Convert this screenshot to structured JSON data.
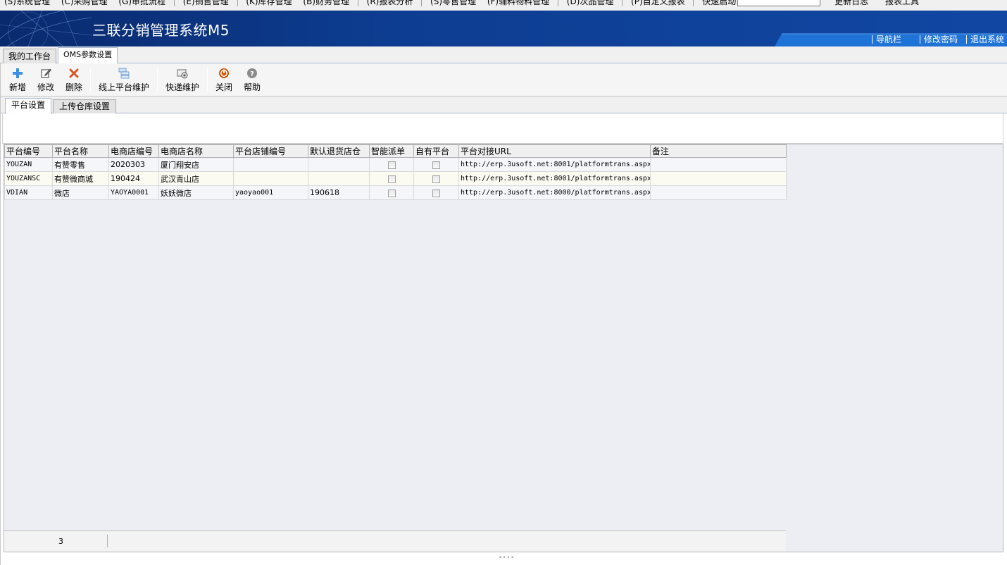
{
  "menu": {
    "items": [
      "(S)系统管理",
      "(C)采购管理",
      "(G)审批流程",
      "(E)销售管理",
      "(K)库存管理",
      "(B)财务管理",
      "(R)报表分析",
      "(S)零售管理",
      "(F)辅料物料管理",
      "(D)次品管理",
      "(P)自定义报表"
    ],
    "quick_start_label": "快速启动",
    "quick_start_value": "",
    "extra_items": [
      "更新日志",
      "报表工具"
    ]
  },
  "banner": {
    "title": "三联分销管理系统M5",
    "links": [
      "导航栏",
      "修改密码",
      "退出系统"
    ]
  },
  "main_tabs": [
    "我的工作台",
    "OMS参数设置"
  ],
  "toolbar": {
    "buttons": [
      "新增",
      "修改",
      "删除",
      "线上平台维护",
      "快递维护",
      "关闭",
      "帮助"
    ]
  },
  "sub_tabs": [
    "平台设置",
    "上传仓库设置"
  ],
  "grid": {
    "columns": [
      "平台编号",
      "平台名称",
      "电商店编号",
      "电商店名称",
      "平台店铺编号",
      "默认退货店仓",
      "智能派单",
      "自有平台",
      "平台对接URL",
      "备注"
    ],
    "rows": [
      {
        "code": "YOUZAN",
        "name": "有赞零售",
        "shop_code": "2020303",
        "shop_name": "厦门翔安店",
        "platform_shop_code": "",
        "return_store": "",
        "smart_dispatch": false,
        "own_platform": false,
        "url": "http://erp.3usoft.net:8001/platformtrans.aspx",
        "note": ""
      },
      {
        "code": "YOUZANSC",
        "name": "有赞微商城",
        "shop_code": "190424",
        "shop_name": "武汉青山店",
        "platform_shop_code": "",
        "return_store": "",
        "smart_dispatch": false,
        "own_platform": false,
        "url": "http://erp.3usoft.net:8001/platformtrans.aspx",
        "note": ""
      },
      {
        "code": "VDIAN",
        "name": "微店",
        "shop_code": "YAOYA0001",
        "shop_name": "妖妖微店",
        "platform_shop_code": "yaoyao001",
        "return_store": "190618",
        "smart_dispatch": false,
        "own_platform": false,
        "url": "http://erp.3usoft.net:8000/platformtrans.aspx",
        "note": ""
      }
    ],
    "row_count": "3"
  },
  "colors": {
    "banner": "#0d3d92",
    "add_icon": "#3a8ee6",
    "delete_icon": "#d8572a",
    "close_icon": "#c0392b"
  }
}
